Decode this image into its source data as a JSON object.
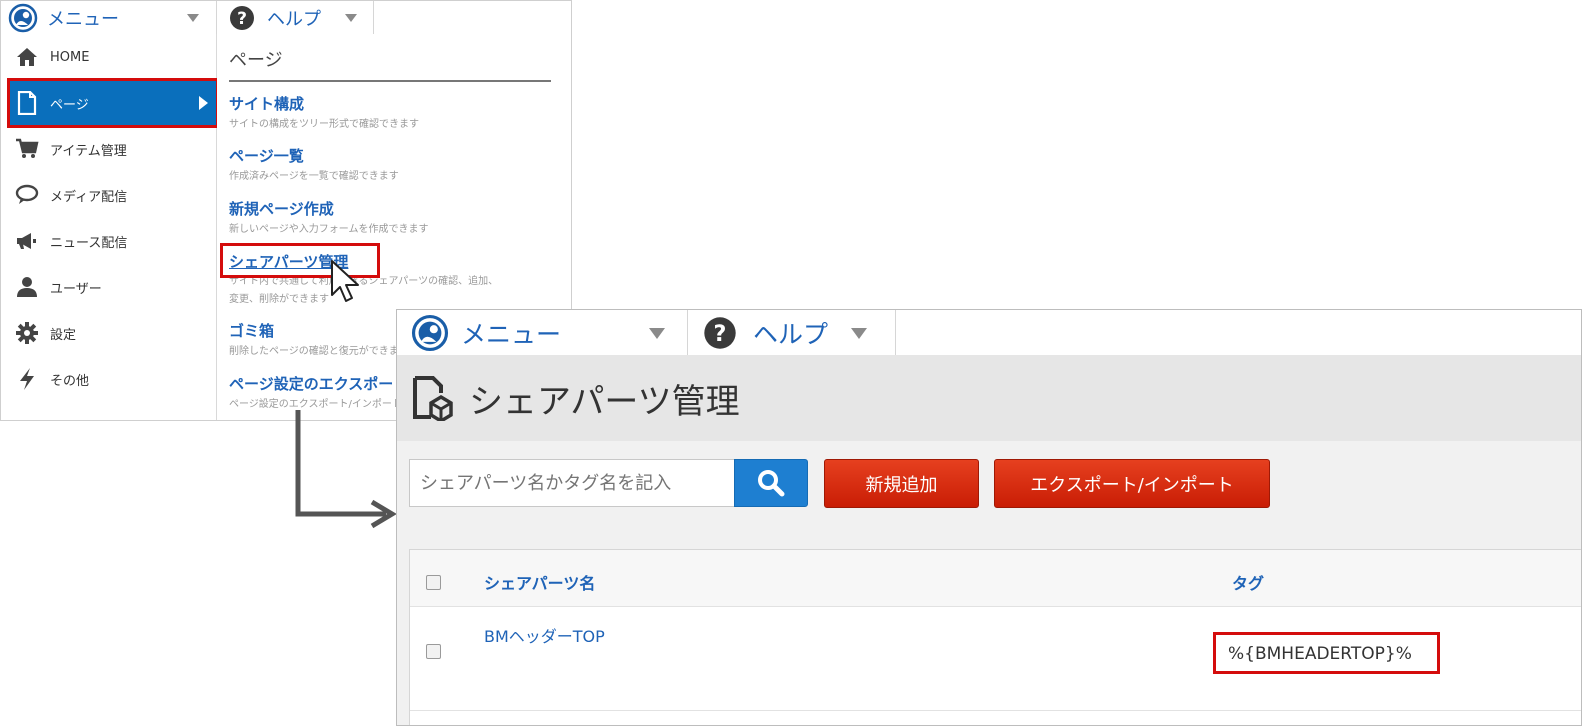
{
  "menu_screen": {
    "topbar": {
      "menu_label": "メニュー",
      "help_label": "ヘルプ"
    },
    "sidenav": {
      "items": [
        {
          "label": "HOME",
          "icon": "home-icon"
        },
        {
          "label": "ページ",
          "icon": "page-icon",
          "active": true
        },
        {
          "label": "アイテム管理",
          "icon": "cart-icon"
        },
        {
          "label": "メディア配信",
          "icon": "speech-bubble-icon"
        },
        {
          "label": "ニュース配信",
          "icon": "megaphone-icon"
        },
        {
          "label": "ユーザー",
          "icon": "user-icon"
        },
        {
          "label": "設定",
          "icon": "gear-icon"
        },
        {
          "label": "その他",
          "icon": "lightning-icon"
        }
      ]
    },
    "submenu": {
      "heading": "ページ",
      "entries": [
        {
          "label": "サイト構成",
          "desc": "サイトの構成をツリー形式で確認できます"
        },
        {
          "label": "ページ一覧",
          "desc": "作成済みページを一覧で確認できます"
        },
        {
          "label": "新規ページ作成",
          "desc": "新しいページや入力フォームを作成できます"
        },
        {
          "label": "シェアパーツ管理",
          "desc_line1": "サイト内で共通して利用できるシェアパーツの確認、追加、",
          "desc_line2": "変更、削除ができます"
        },
        {
          "label": "ゴミ箱",
          "desc": "削除したページの確認と復元ができます"
        },
        {
          "label": "ページ設定のエクスポート/インポート",
          "desc": "ページ設定のエクスポート/インポートができます"
        }
      ]
    }
  },
  "share_parts_screen": {
    "topbar": {
      "menu_label": "メニュー",
      "help_label": "ヘルプ"
    },
    "page_title": "シェアパーツ管理",
    "search": {
      "placeholder": "シェアパーツ名かタグ名を記入"
    },
    "buttons": {
      "add": "新規追加",
      "export_import": "エクスポート/インポート"
    },
    "table": {
      "headers": [
        "シェアパーツ名",
        "タグ"
      ],
      "rows": [
        {
          "name": "BMヘッダーTOP",
          "tag": "%{BMHEADERTOP}%"
        }
      ]
    }
  },
  "colors": {
    "accent_blue": "#0a6fbc",
    "link_blue": "#1f63b7",
    "highlight_red": "#d40c0c",
    "button_red": "#d52d0f"
  }
}
